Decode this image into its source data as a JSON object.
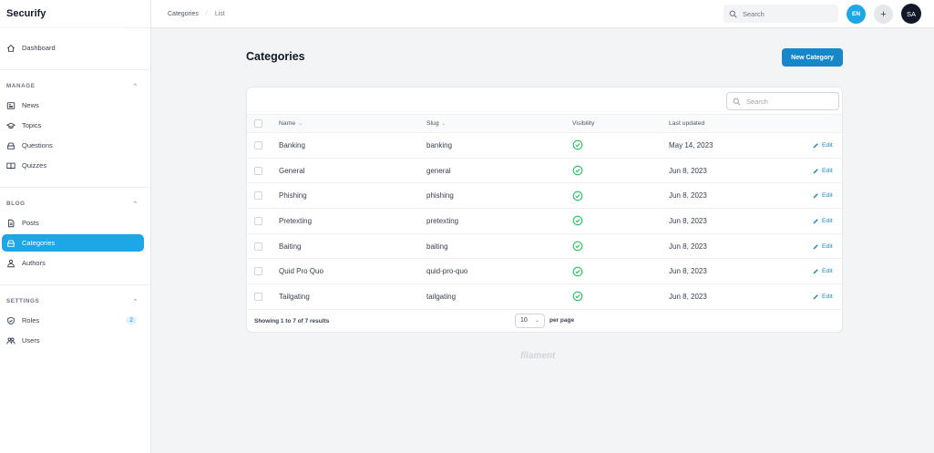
{
  "app": {
    "name": "Securify"
  },
  "breadcrumb": [
    "Categories",
    "List"
  ],
  "topbar": {
    "search_placeholder": "Search",
    "lang": "EN",
    "plus": "+",
    "avatar": "SA"
  },
  "sidebar": {
    "dashboard": "Dashboard",
    "groups": [
      {
        "label": "MANAGE",
        "items": [
          "News",
          "Topics",
          "Questions",
          "Quizzes"
        ]
      },
      {
        "label": "BLOG",
        "items": [
          "Posts",
          "Categories",
          "Authors"
        ]
      },
      {
        "label": "SETTINGS",
        "items": [
          "Roles",
          "Users"
        ]
      }
    ],
    "roles_badge": "2",
    "active": "Categories"
  },
  "page": {
    "title": "Categories",
    "new_button": "New Category"
  },
  "table": {
    "search_placeholder": "Search",
    "headers": {
      "name": "Name",
      "slug": "Slug",
      "visibility": "Visibility",
      "updated": "Last updated"
    },
    "edit_label": "Edit",
    "rows": [
      {
        "name": "Banking",
        "slug": "banking",
        "visible": true,
        "updated": "May 14, 2023"
      },
      {
        "name": "General",
        "slug": "general",
        "visible": true,
        "updated": "Jun 8, 2023"
      },
      {
        "name": "Phishing",
        "slug": "phishing",
        "visible": true,
        "updated": "Jun 8, 2023"
      },
      {
        "name": "Pretexting",
        "slug": "pretexting",
        "visible": true,
        "updated": "Jun 8, 2023"
      },
      {
        "name": "Baiting",
        "slug": "baiting",
        "visible": true,
        "updated": "Jun 8, 2023"
      },
      {
        "name": "Quid Pro Quo",
        "slug": "quid-pro-quo",
        "visible": true,
        "updated": "Jun 8, 2023"
      },
      {
        "name": "Tailgating",
        "slug": "tailgating",
        "visible": true,
        "updated": "Jun 8, 2023"
      }
    ],
    "footer_text": "Showing 1 to 7 of 7 results",
    "per_page_value": "10",
    "per_page_label": "per page"
  },
  "footer_brand": "filament",
  "colors": {
    "primary": "#1ea7e6",
    "button": "#1688c9",
    "success": "#22c55e"
  }
}
